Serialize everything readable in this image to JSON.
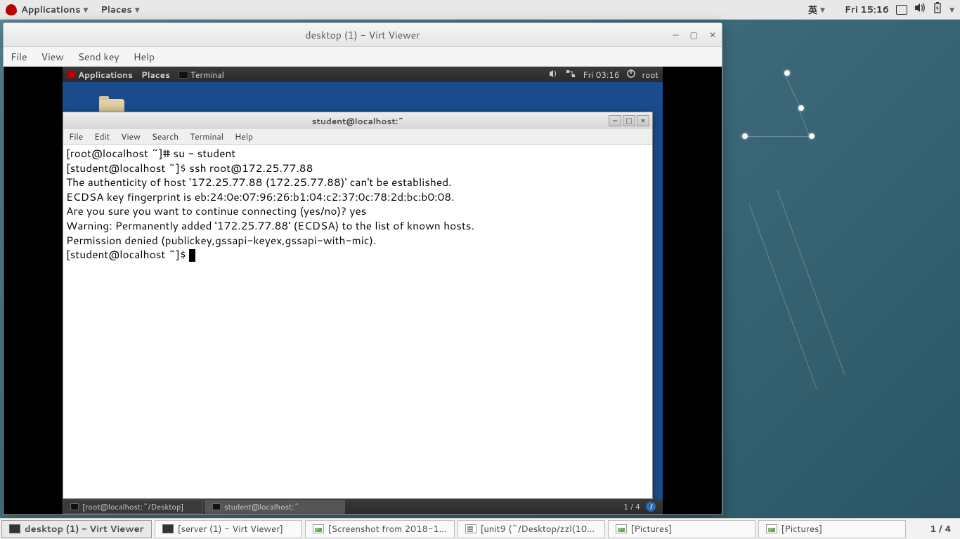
{
  "host": {
    "topbar": {
      "applications": "Applications",
      "places": "Places",
      "lang": "英",
      "datetime": "Fri 15:16"
    },
    "taskbar": {
      "items": [
        {
          "label": "desktop (1) - Virt Viewer",
          "active": true,
          "icon": "term"
        },
        {
          "label": "[server (1) - Virt Viewer]",
          "active": false,
          "icon": "term"
        },
        {
          "label": "[Screenshot from 2018-1...",
          "active": false,
          "icon": "pic"
        },
        {
          "label": "[unit9 (~/Desktop/zzl(10...",
          "active": false,
          "icon": "doc"
        },
        {
          "label": "[Pictures]",
          "active": false,
          "icon": "pic"
        },
        {
          "label": "[Pictures]",
          "active": false,
          "icon": "pic"
        }
      ],
      "workspace": "1 / 4"
    }
  },
  "virt": {
    "title": "desktop (1) - Virt Viewer",
    "menu": {
      "file": "File",
      "view": "View",
      "sendkey": "Send key",
      "help": "Help"
    }
  },
  "guest": {
    "topbar": {
      "applications": "Applications",
      "places": "Places",
      "terminal": "Terminal",
      "datetime": "Fri 03:16",
      "user": "root"
    },
    "taskbar": {
      "items": [
        {
          "label": "[root@localhost:~/Desktop]",
          "active": false
        },
        {
          "label": "student@localhost:~",
          "active": true
        }
      ],
      "workspace": "1 / 4"
    }
  },
  "terminal": {
    "title": "student@localhost:~",
    "menu": {
      "file": "File",
      "edit": "Edit",
      "view": "View",
      "search": "Search",
      "terminal": "Terminal",
      "help": "Help"
    },
    "lines": [
      "[root@localhost ~]# su - student",
      "[student@localhost ~]$ ssh root@172.25.77.88",
      "The authenticity of host '172.25.77.88 (172.25.77.88)' can't be established.",
      "ECDSA key fingerprint is eb:24:0e:07:96:26:b1:04:c2:37:0c:78:2d:bc:b0:08.",
      "Are you sure you want to continue connecting (yes/no)? yes",
      "Warning: Permanently added '172.25.77.88' (ECDSA) to the list of known hosts.",
      "Permission denied (publickey,gssapi-keyex,gssapi-with-mic).",
      "[student@localhost ~]$ "
    ]
  }
}
